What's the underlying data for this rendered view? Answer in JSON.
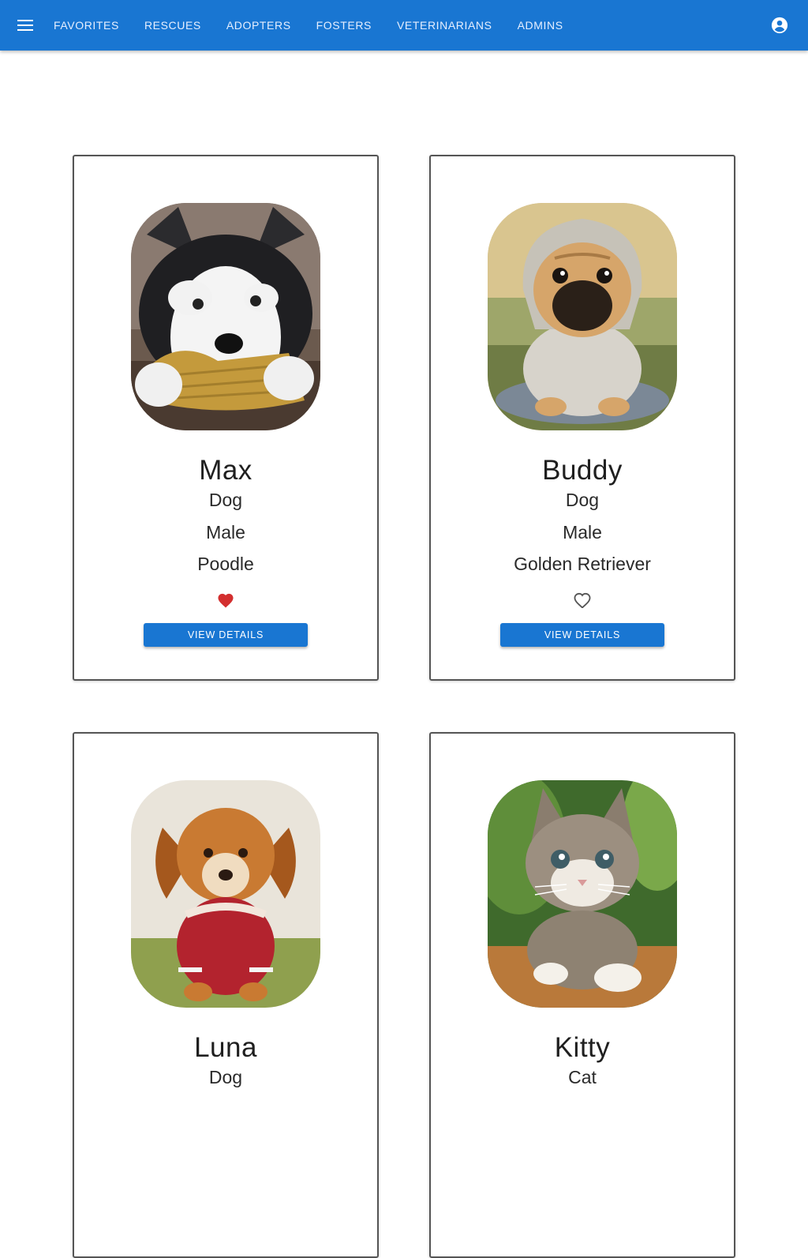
{
  "nav": {
    "menu_icon": "menu-icon",
    "items": [
      {
        "label": "FAVORITES"
      },
      {
        "label": "RESCUES"
      },
      {
        "label": "ADOPTERS"
      },
      {
        "label": "FOSTERS"
      },
      {
        "label": "VETERINARIANS"
      },
      {
        "label": "ADMINS"
      }
    ],
    "account_icon": "account-circle-icon"
  },
  "colors": {
    "app_bar": "#1976d2",
    "button": "#1976d2",
    "favorite_active": "#d32f2f",
    "favorite_inactive": "#555555"
  },
  "pets": [
    {
      "name": "Max",
      "species": "Dog",
      "gender": "Male",
      "breed": "Poodle",
      "favorite": true,
      "button_label": "VIEW DETAILS",
      "photo": "husky-puppy-photo"
    },
    {
      "name": "Buddy",
      "species": "Dog",
      "gender": "Male",
      "breed": "Golden Retriever",
      "favorite": false,
      "button_label": "VIEW DETAILS",
      "photo": "pug-puppy-photo"
    },
    {
      "name": "Luna",
      "species": "Dog",
      "gender": "",
      "breed": "",
      "favorite": false,
      "button_label": "",
      "photo": "golden-puppy-photo"
    },
    {
      "name": "Kitty",
      "species": "Cat",
      "gender": "",
      "breed": "",
      "favorite": false,
      "button_label": "",
      "photo": "tabby-kitten-photo"
    }
  ]
}
